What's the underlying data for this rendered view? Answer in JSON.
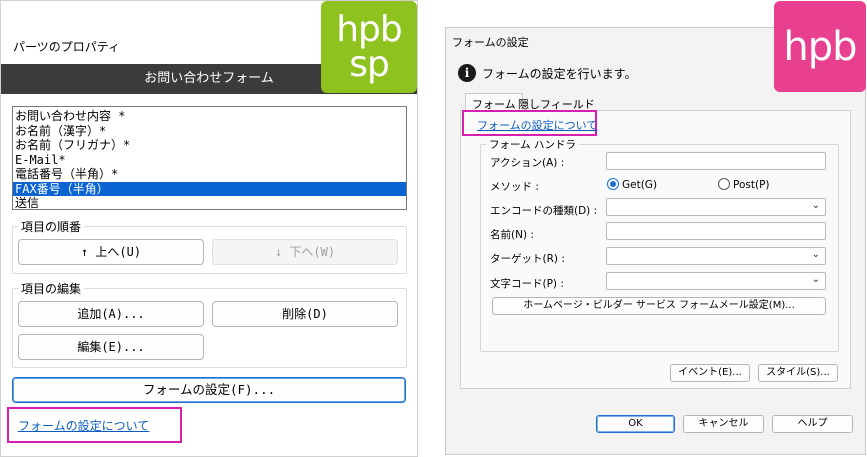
{
  "left": {
    "title": "パーツのプロパティ",
    "header": "お問い合わせフォーム",
    "list_items": [
      "お問い合わせ内容 *",
      "お名前（漢字）*",
      "お名前（フリガナ）*",
      "E-Mail*",
      "電話番号（半角）*",
      "FAX番号（半角）",
      "送信"
    ],
    "selected_index": 5,
    "group_order": {
      "title": "項目の順番",
      "up": "↑ 上へ(U)",
      "down": "↓ 下へ(W)"
    },
    "group_edit": {
      "title": "項目の編集",
      "add": "追加(A)...",
      "delete": "削除(D)",
      "edit": "編集(E)..."
    },
    "form_settings_button": "フォームの設定(F)...",
    "about_link": "フォームの設定について"
  },
  "badges": {
    "sp": {
      "line1": "hpb",
      "line2": "sp",
      "color": "#8dc21f"
    },
    "hpb": {
      "text": "hpb",
      "color": "#e8408f"
    }
  },
  "right": {
    "title": "フォームの設定",
    "info": "フォームの設定を行います。",
    "tabs": [
      "フォーム",
      "隠しフィールド"
    ],
    "about_link": "フォームの設定について",
    "section": "フォーム ハンドラ",
    "fields": {
      "action": "アクション(A) :",
      "method": "メソッド :",
      "get": "Get(G)",
      "post": "Post(P)",
      "encoding": "エンコードの種類(D) :",
      "name": "名前(N) :",
      "target": "ターゲット(R) :",
      "charset": "文字コード(P) :"
    },
    "mail_button": "ホームページ・ビルダー サービス フォームメール設定(M)...",
    "event_button": "イベント(E)...",
    "style_button": "スタイル(S)...",
    "ok": "OK",
    "cancel": "キャンセル",
    "help": "ヘルプ"
  }
}
